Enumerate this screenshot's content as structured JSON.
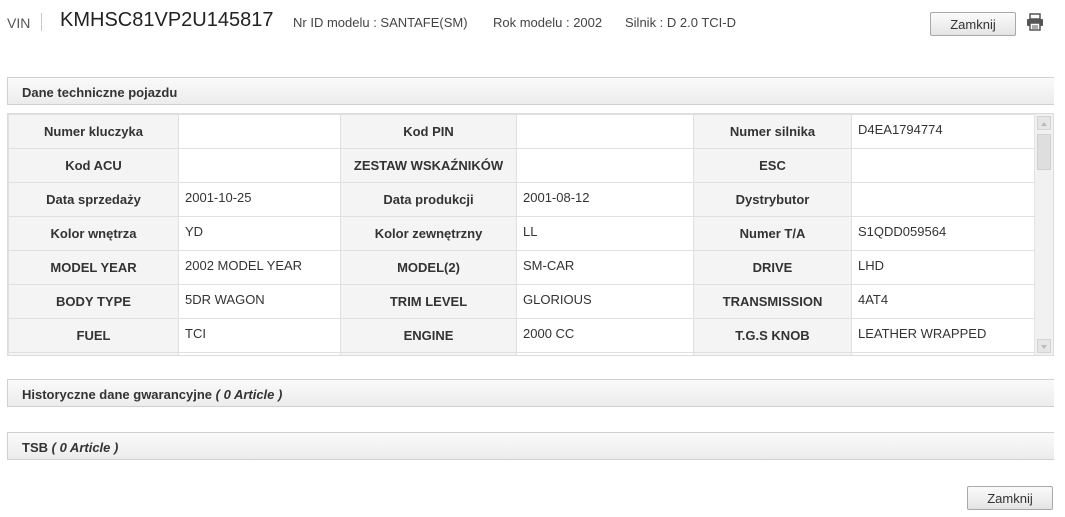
{
  "header": {
    "vin_label": "VIN",
    "vin_value": "KMHSC81VP2U145817",
    "model_id": "Nr ID modelu : SANTAFE(SM)",
    "model_year": "Rok modelu : 2002",
    "engine": "Silnik : D 2.0 TCI-D",
    "close_label": "Zamknij",
    "print_icon": "printer-icon"
  },
  "tech_section": {
    "title": "Dane techniczne pojazdu",
    "rows": [
      [
        {
          "label": "Numer kluczyka",
          "value": ""
        },
        {
          "label": "Kod PIN",
          "value": ""
        },
        {
          "label": "Numer silnika",
          "value": "D4EA1794774"
        }
      ],
      [
        {
          "label": "Kod ACU",
          "value": ""
        },
        {
          "label": "ZESTAW WSKAŹNIKÓW",
          "value": ""
        },
        {
          "label": "ESC",
          "value": ""
        }
      ],
      [
        {
          "label": "Data sprzedaży",
          "value": "2001-10-25"
        },
        {
          "label": "Data produkcji",
          "value": "2001-08-12"
        },
        {
          "label": "Dystrybutor",
          "value": ""
        }
      ],
      [
        {
          "label": "Kolor wnętrza",
          "value": "YD"
        },
        {
          "label": "Kolor zewnętrzny",
          "value": "LL"
        },
        {
          "label": "Numer T/A",
          "value": "S1QDD059564"
        }
      ],
      [
        {
          "label": "MODEL YEAR",
          "value": "2002 MODEL YEAR"
        },
        {
          "label": "MODEL(2)",
          "value": "SM-CAR"
        },
        {
          "label": "DRIVE",
          "value": "LHD"
        }
      ],
      [
        {
          "label": "BODY TYPE",
          "value": "5DR WAGON"
        },
        {
          "label": "TRIM LEVEL",
          "value": "GLORIOUS"
        },
        {
          "label": "TRANSMISSION",
          "value": "4AT4"
        }
      ],
      [
        {
          "label": "FUEL",
          "value": "TCI"
        },
        {
          "label": "ENGINE",
          "value": "2000 CC"
        },
        {
          "label": "T.G.S KNOB",
          "value": "LEATHER WRAPPED"
        }
      ],
      [
        {
          "label": "",
          "value": ""
        },
        {
          "label": "",
          "value": ""
        },
        {
          "label": "",
          "value": ""
        }
      ]
    ]
  },
  "warranty_section": {
    "title": "Historyczne dane gwarancyjne",
    "count": "( 0 Article )"
  },
  "tsb_section": {
    "title": "TSB",
    "count": "( 0 Article )"
  },
  "footer": {
    "close_label": "Zamknij"
  }
}
